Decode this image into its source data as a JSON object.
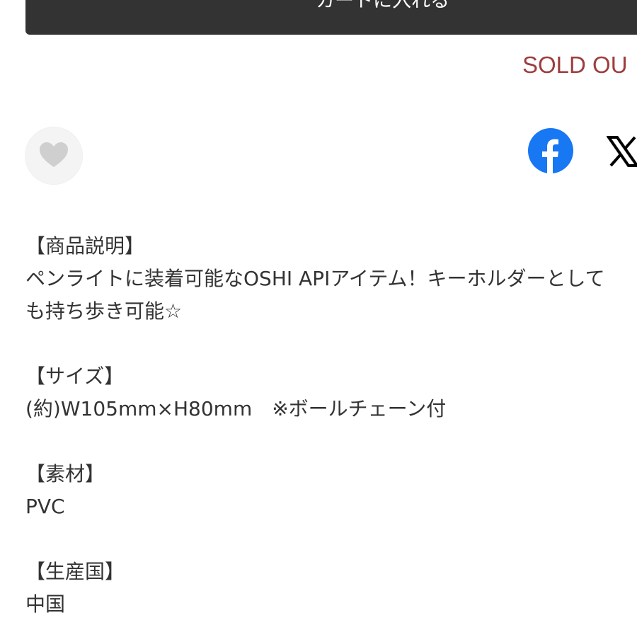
{
  "top_button": {
    "label": "カートに入れる"
  },
  "status": {
    "sold_out": "SOLD OU"
  },
  "social": {
    "favorite_icon": "heart-icon",
    "facebook_icon": "facebook-icon",
    "x_icon": "x-icon"
  },
  "description": {
    "heading": "【商品説明】",
    "line1": "ペンライトに装着可能なOSHI APIアイテム！キーホルダーとして",
    "line2": "も持ち歩き可能☆",
    "size_heading": "【サイズ】",
    "size_value": "(約)W105mm×H80mm　※ボールチェーン付",
    "material_heading": "【素材】",
    "material_value": "PVC",
    "origin_heading": "【生産国】",
    "origin_value": "中国"
  },
  "colors": {
    "button_bg": "#333333",
    "sold_out": "#9e3d3d",
    "facebook": "#1877f2",
    "text": "#333333"
  }
}
